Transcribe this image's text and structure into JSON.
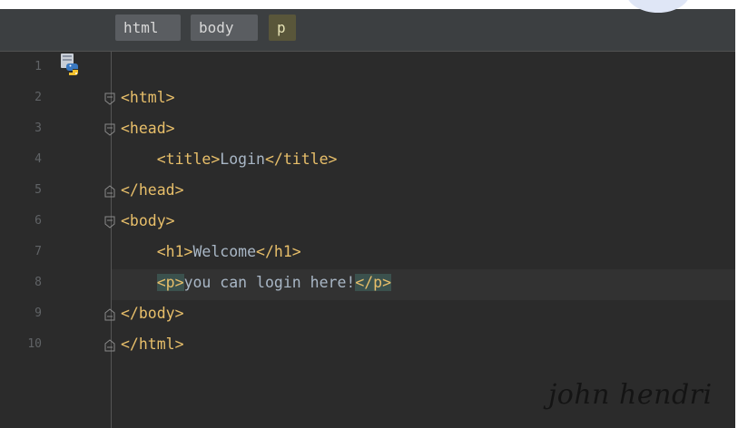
{
  "breadcrumbs": [
    {
      "label": "html"
    },
    {
      "label": "body"
    },
    {
      "label": "p"
    }
  ],
  "editor": {
    "line_numbers": [
      "1",
      "2",
      "3",
      "4",
      "5",
      "6",
      "7",
      "8",
      "9",
      "10"
    ],
    "lines": [
      {
        "indent": "",
        "parts": []
      },
      {
        "indent": "",
        "parts": [
          {
            "t": "tag",
            "v": "<html>"
          }
        ]
      },
      {
        "indent": "",
        "parts": [
          {
            "t": "tag",
            "v": "<head>"
          }
        ]
      },
      {
        "indent": "    ",
        "parts": [
          {
            "t": "tag",
            "v": "<title>"
          },
          {
            "t": "txt",
            "v": "Login"
          },
          {
            "t": "tag",
            "v": "</title>"
          }
        ]
      },
      {
        "indent": "",
        "parts": [
          {
            "t": "tag",
            "v": "</head>"
          }
        ]
      },
      {
        "indent": "",
        "parts": [
          {
            "t": "tag",
            "v": "<body>"
          }
        ]
      },
      {
        "indent": "    ",
        "parts": [
          {
            "t": "tag",
            "v": "<h1>"
          },
          {
            "t": "txt",
            "v": "Welcome"
          },
          {
            "t": "tag",
            "v": "</h1>"
          }
        ]
      },
      {
        "indent": "    ",
        "parts": [
          {
            "t": "taghl",
            "v": "<p>"
          },
          {
            "t": "txt",
            "v": "you can login here!"
          },
          {
            "t": "taghl",
            "v": "</p>"
          }
        ]
      },
      {
        "indent": "",
        "parts": [
          {
            "t": "tag",
            "v": "</body>"
          }
        ]
      },
      {
        "indent": "",
        "parts": [
          {
            "t": "tag",
            "v": "</html>"
          }
        ]
      }
    ],
    "current_line": 8
  },
  "watermark": "john hendri",
  "colors": {
    "background": "#2b2b2b",
    "tag": "#e8bf6a",
    "text": "#a9b7c6",
    "line_number": "#606366",
    "tag_highlight": "#3b514d"
  },
  "icons": {
    "file_type": "python-file-icon",
    "fold_open": "fold-open-icon",
    "fold_close": "fold-close-icon"
  }
}
